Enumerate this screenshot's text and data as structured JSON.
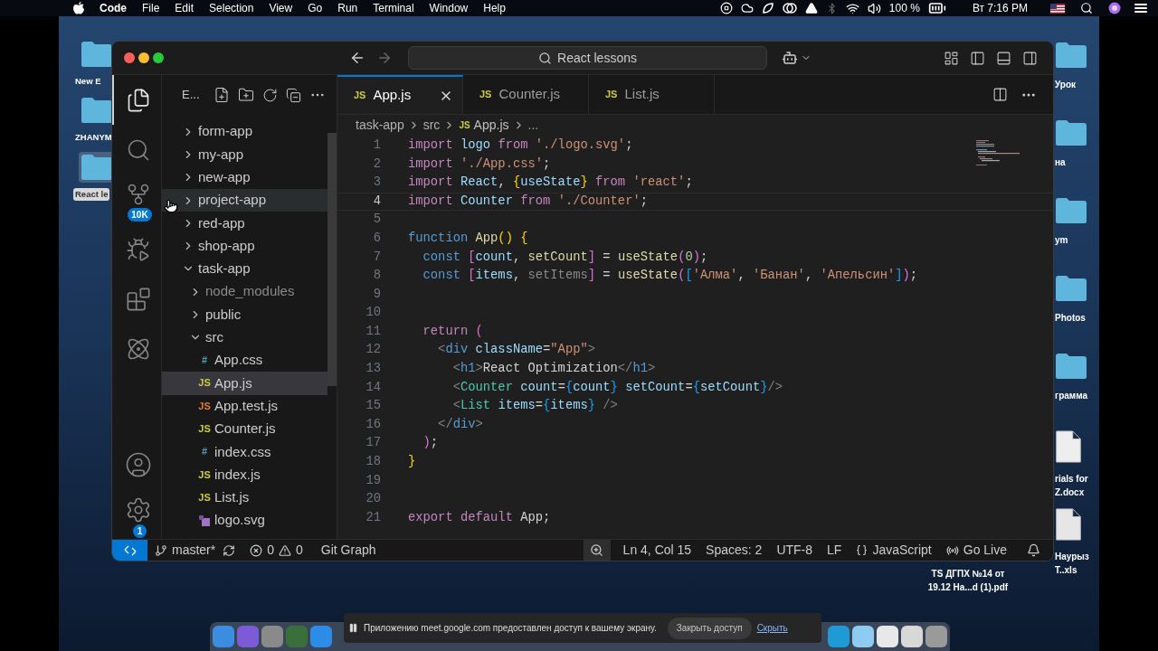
{
  "menu_bar": {
    "app_name": "Code",
    "menus": [
      "File",
      "Edit",
      "Selection",
      "View",
      "Go",
      "Run",
      "Terminal",
      "Window",
      "Help"
    ],
    "battery": "100 %",
    "clock": "Вт 7:16 PM"
  },
  "desktop_left": [
    {
      "label": "New E",
      "kind": "folder",
      "selected": false
    },
    {
      "label": "ZHANYM",
      "kind": "folder",
      "selected": false
    },
    {
      "label": "React le",
      "kind": "folder",
      "selected": true
    }
  ],
  "desktop_right": [
    {
      "lines": [
        "Урок"
      ],
      "kind": "folder"
    },
    {
      "lines": [
        "на"
      ],
      "kind": "folder"
    },
    {
      "lines": [
        "ym"
      ],
      "kind": "folder"
    },
    {
      "lines": [
        "Photos"
      ],
      "kind": "folder"
    },
    {
      "lines": [
        "грамма"
      ],
      "kind": "folder"
    },
    {
      "lines": [
        "rials for",
        "Z.docx"
      ],
      "kind": "docx"
    },
    {
      "lines": [
        "Наурыз",
        "T..xls"
      ],
      "kind": "xls"
    }
  ],
  "desktop_file_label": {
    "lines": [
      "TS ДГПХ №14 от",
      "19.12 На...d (1).pdf"
    ]
  },
  "window": {
    "search": "React lessons"
  },
  "activity_bar": {
    "items": [
      {
        "kind": "files",
        "selected": true
      },
      {
        "kind": "search",
        "selected": false
      },
      {
        "kind": "source_control",
        "selected": false,
        "badge": "10K"
      },
      {
        "kind": "run_debug",
        "selected": false
      },
      {
        "kind": "extensions",
        "selected": false
      },
      {
        "kind": "react",
        "selected": false
      }
    ],
    "bottom": [
      {
        "kind": "account"
      },
      {
        "kind": "settings",
        "badge": "1"
      }
    ]
  },
  "explorer": {
    "title": "E...",
    "tree": [
      {
        "name": "form-app",
        "kind": "folder",
        "expanded": false,
        "dimmed": false,
        "selected": false,
        "hovered": false
      },
      {
        "name": "my-app",
        "kind": "folder",
        "expanded": false,
        "dimmed": false,
        "selected": false,
        "hovered": false
      },
      {
        "name": "new-app",
        "kind": "folder",
        "expanded": false,
        "dimmed": false,
        "selected": false,
        "hovered": false
      },
      {
        "name": "project-app",
        "kind": "folder",
        "expanded": false,
        "dimmed": false,
        "selected": false,
        "hovered": true
      },
      {
        "name": "red-app",
        "kind": "folder",
        "expanded": false,
        "dimmed": false,
        "selected": false,
        "hovered": false
      },
      {
        "name": "shop-app",
        "kind": "folder",
        "expanded": false,
        "dimmed": false,
        "selected": false,
        "hovered": false
      },
      {
        "name": "task-app",
        "kind": "folder",
        "expanded": true,
        "dimmed": false,
        "selected": false,
        "hovered": false,
        "children": [
          {
            "name": "node_modules",
            "kind": "folder",
            "expanded": false,
            "dimmed": true,
            "selected": false,
            "hovered": false
          },
          {
            "name": "public",
            "kind": "folder",
            "expanded": false,
            "dimmed": false,
            "selected": false,
            "hovered": false
          },
          {
            "name": "src",
            "kind": "folder",
            "expanded": true,
            "dimmed": false,
            "selected": false,
            "hovered": false,
            "children": [
              {
                "name": "App.css",
                "kind": "css",
                "icon_text": "#",
                "selected": false,
                "hovered": false
              },
              {
                "name": "App.js",
                "kind": "js",
                "icon_text": "JS",
                "selected": true,
                "hovered": false
              },
              {
                "name": "App.test.js",
                "kind": "test",
                "icon_text": "JS",
                "selected": false,
                "hovered": false
              },
              {
                "name": "Counter.js",
                "kind": "js",
                "icon_text": "JS",
                "selected": false,
                "hovered": false
              },
              {
                "name": "index.css",
                "kind": "css",
                "icon_text": "#",
                "selected": false,
                "hovered": false
              },
              {
                "name": "index.js",
                "kind": "js",
                "icon_text": "JS",
                "selected": false,
                "hovered": false
              },
              {
                "name": "List.js",
                "kind": "js",
                "icon_text": "JS",
                "selected": false,
                "hovered": false
              },
              {
                "name": "logo.svg",
                "kind": "svg",
                "selected": false,
                "hovered": false
              }
            ]
          }
        ]
      }
    ]
  },
  "tabs": [
    {
      "name": "App.js",
      "icon_text": "JS",
      "selected": true
    },
    {
      "name": "Counter.js",
      "icon_text": "JS",
      "selected": false
    },
    {
      "name": "List.js",
      "icon_text": "JS",
      "selected": false
    }
  ],
  "breadcrumb": [
    {
      "text": "task-app",
      "kind": "folder"
    },
    {
      "text": "src",
      "kind": "folder"
    },
    {
      "text": "App.js",
      "kind": "js",
      "icon_text": "JS"
    },
    {
      "text": "...",
      "kind": "symbol"
    }
  ],
  "code": [
    {
      "number": "1",
      "current": false,
      "tokens": [
        {
          "kind": "kw",
          "text": "import "
        },
        {
          "kind": "var",
          "text": "logo "
        },
        {
          "kind": "kw",
          "text": "from "
        },
        {
          "kind": "str",
          "text": "'./logo.svg'"
        },
        {
          "kind": "p",
          "text": ";"
        }
      ]
    },
    {
      "number": "2",
      "current": false,
      "tokens": [
        {
          "kind": "kw",
          "text": "import "
        },
        {
          "kind": "str",
          "text": "'./App.css'"
        },
        {
          "kind": "p",
          "text": ";"
        }
      ]
    },
    {
      "number": "3",
      "current": false,
      "tokens": [
        {
          "kind": "kw",
          "text": "import "
        },
        {
          "kind": "var",
          "text": "React"
        },
        {
          "kind": "p",
          "text": ", "
        },
        {
          "kind": "b1",
          "text": "{"
        },
        {
          "kind": "var",
          "text": "useState"
        },
        {
          "kind": "b1",
          "text": "}"
        },
        {
          "kind": "kw",
          "text": " from "
        },
        {
          "kind": "str",
          "text": "'react'"
        },
        {
          "kind": "p",
          "text": ";"
        }
      ]
    },
    {
      "number": "4",
      "current": true,
      "tokens": [
        {
          "kind": "kw",
          "text": "import "
        },
        {
          "kind": "var",
          "text": "Counter"
        },
        {
          "kind": "kw",
          "text": " from "
        },
        {
          "kind": "str",
          "text": "'./Counter'"
        },
        {
          "kind": "p",
          "text": ";"
        }
      ]
    },
    {
      "number": "5",
      "current": false
    },
    {
      "number": "6",
      "current": false,
      "tokens": [
        {
          "kind": "decl",
          "text": "function "
        },
        {
          "kind": "fn",
          "text": "App"
        },
        {
          "kind": "b1",
          "text": "() {"
        }
      ]
    },
    {
      "number": "7",
      "current": false,
      "tokens": [
        {
          "kind": "decl",
          "text": "  const "
        },
        {
          "kind": "b2",
          "text": "["
        },
        {
          "kind": "var",
          "text": "count"
        },
        {
          "kind": "p",
          "text": ", "
        },
        {
          "kind": "fn",
          "text": "setCount"
        },
        {
          "kind": "b2",
          "text": "]"
        },
        {
          "kind": "p",
          "text": " = "
        },
        {
          "kind": "fn",
          "text": "useState"
        },
        {
          "kind": "b2",
          "text": "("
        },
        {
          "kind": "num",
          "text": "0"
        },
        {
          "kind": "b2",
          "text": ")"
        },
        {
          "kind": "p",
          "text": ";"
        }
      ]
    },
    {
      "number": "8",
      "current": false,
      "tokens": [
        {
          "kind": "decl",
          "text": "  const "
        },
        {
          "kind": "b2",
          "text": "["
        },
        {
          "kind": "var",
          "text": "items"
        },
        {
          "kind": "p",
          "text": ", "
        },
        {
          "kind": "dim",
          "text": "setItems"
        },
        {
          "kind": "b2",
          "text": "]"
        },
        {
          "kind": "p",
          "text": " = "
        },
        {
          "kind": "fn",
          "text": "useState"
        },
        {
          "kind": "b2",
          "text": "("
        },
        {
          "kind": "b3",
          "text": "["
        },
        {
          "kind": "str",
          "text": "'Алма'"
        },
        {
          "kind": "p",
          "text": ", "
        },
        {
          "kind": "str",
          "text": "'Банан'"
        },
        {
          "kind": "p",
          "text": ", "
        },
        {
          "kind": "str",
          "text": "'Апельсин'"
        },
        {
          "kind": "b3",
          "text": "]"
        },
        {
          "kind": "b2",
          "text": ")"
        },
        {
          "kind": "p",
          "text": ";"
        }
      ]
    },
    {
      "number": "9",
      "current": false
    },
    {
      "number": "10",
      "current": false
    },
    {
      "number": "11",
      "current": false,
      "tokens": [
        {
          "kind": "kw",
          "text": "  return "
        },
        {
          "kind": "b2",
          "text": "("
        }
      ]
    },
    {
      "number": "12",
      "current": false,
      "tokens": [
        {
          "kind": "tag",
          "text": "    <"
        },
        {
          "kind": "tn",
          "text": "div "
        },
        {
          "kind": "var",
          "text": "className"
        },
        {
          "kind": "p",
          "text": "="
        },
        {
          "kind": "str",
          "text": "\"App\""
        },
        {
          "kind": "tag",
          "text": ">"
        }
      ]
    },
    {
      "number": "13",
      "current": false,
      "tokens": [
        {
          "kind": "tag",
          "text": "      <"
        },
        {
          "kind": "tn",
          "text": "h1"
        },
        {
          "kind": "tag",
          "text": ">"
        },
        {
          "kind": "p",
          "text": "React Optimization"
        },
        {
          "kind": "tag",
          "text": "</"
        },
        {
          "kind": "tn",
          "text": "h1"
        },
        {
          "kind": "tag",
          "text": ">"
        }
      ]
    },
    {
      "number": "14",
      "current": false,
      "tokens": [
        {
          "kind": "tag",
          "text": "      <"
        },
        {
          "kind": "comp",
          "text": "Counter "
        },
        {
          "kind": "var",
          "text": "count"
        },
        {
          "kind": "p",
          "text": "="
        },
        {
          "kind": "b3",
          "text": "{"
        },
        {
          "kind": "var",
          "text": "count"
        },
        {
          "kind": "b3",
          "text": "} "
        },
        {
          "kind": "var",
          "text": "setCount"
        },
        {
          "kind": "p",
          "text": "="
        },
        {
          "kind": "b3",
          "text": "{"
        },
        {
          "kind": "var",
          "text": "setCount"
        },
        {
          "kind": "b3",
          "text": "}"
        },
        {
          "kind": "tag",
          "text": "/>"
        }
      ]
    },
    {
      "number": "15",
      "current": false,
      "tokens": [
        {
          "kind": "tag",
          "text": "      <"
        },
        {
          "kind": "comp",
          "text": "List "
        },
        {
          "kind": "var",
          "text": "items"
        },
        {
          "kind": "p",
          "text": "="
        },
        {
          "kind": "b3",
          "text": "{"
        },
        {
          "kind": "var",
          "text": "items"
        },
        {
          "kind": "b3",
          "text": "} "
        },
        {
          "kind": "tag",
          "text": "/>"
        }
      ]
    },
    {
      "number": "16",
      "current": false,
      "tokens": [
        {
          "kind": "tag",
          "text": "    </"
        },
        {
          "kind": "tn",
          "text": "div"
        },
        {
          "kind": "tag",
          "text": ">"
        }
      ]
    },
    {
      "number": "17",
      "current": false,
      "tokens": [
        {
          "kind": "b2",
          "text": "  )"
        },
        {
          "kind": "p",
          "text": ";"
        }
      ]
    },
    {
      "number": "18",
      "current": false,
      "tokens": [
        {
          "kind": "b1",
          "text": "}"
        }
      ]
    },
    {
      "number": "19",
      "current": false
    },
    {
      "number": "20",
      "current": false
    },
    {
      "number": "21",
      "current": false,
      "tokens": [
        {
          "kind": "kw",
          "text": "export default "
        },
        {
          "kind": "p",
          "text": "App;"
        }
      ]
    }
  ],
  "status_bar": {
    "branch": "master*",
    "errors": "0",
    "warnings": "0",
    "git_graph": "Git Graph",
    "position": "Ln 4, Col 15",
    "spaces": "Spaces: 2",
    "encoding": "UTF-8",
    "eol": "LF",
    "language": "JavaScript",
    "go_live": "Go Live"
  },
  "share_banner": {
    "message": "Приложению meet.google.com предоставлен доступ к вашему экрану.",
    "stop_button": "Закрыть доступ",
    "hide_link": "Скрыть"
  }
}
